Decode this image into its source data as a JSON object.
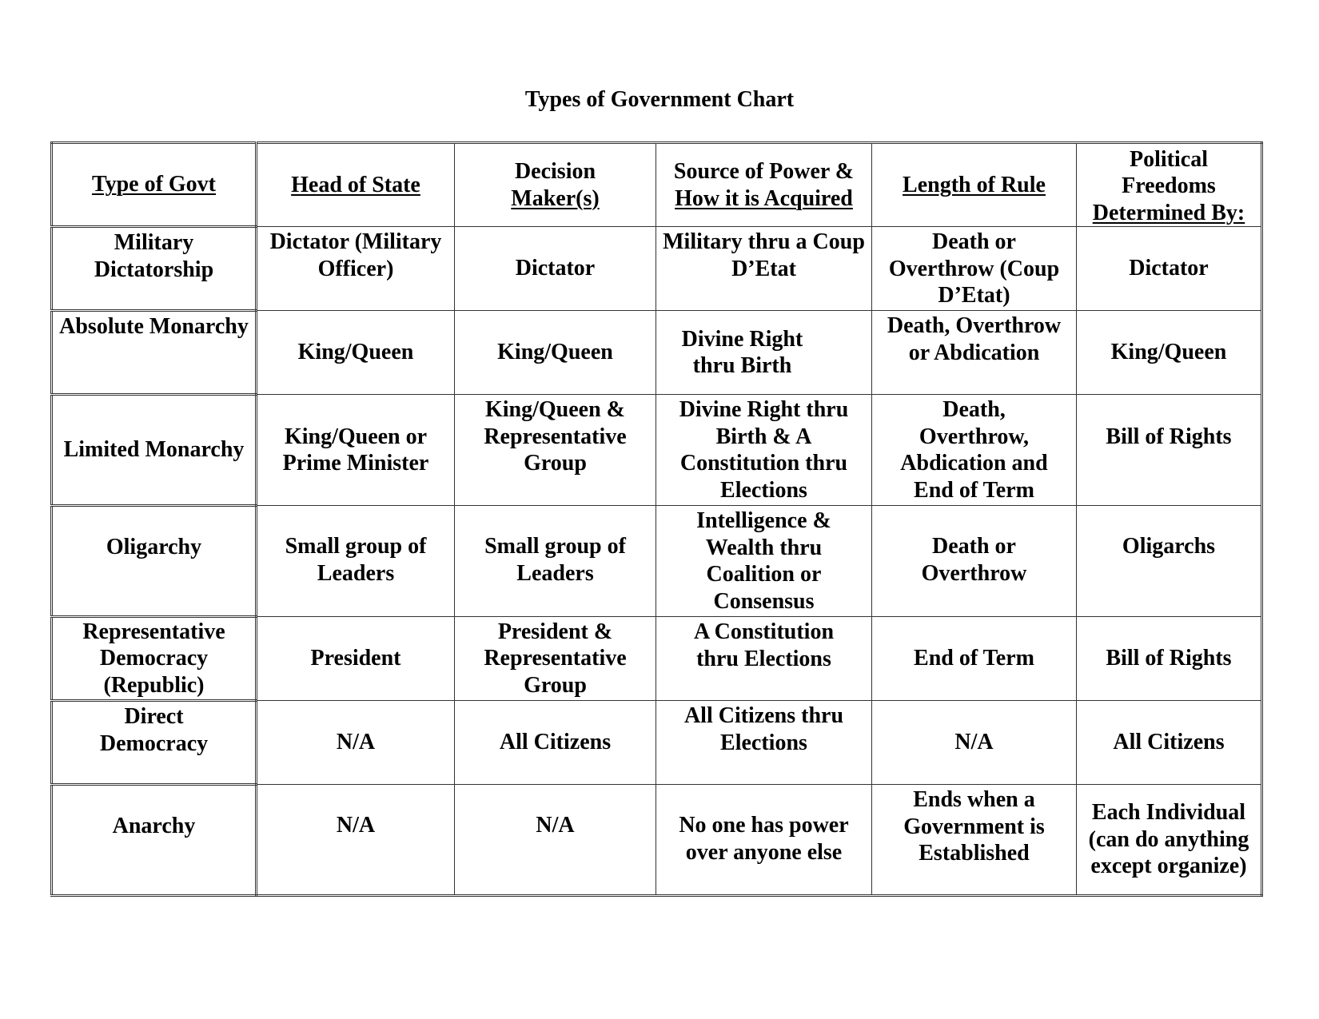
{
  "document": {
    "title": "Types of Government Chart"
  },
  "table": {
    "headers": [
      {
        "lines_plain": "",
        "lines_underlined": "Type of Govt"
      },
      {
        "lines_plain": "",
        "lines_underlined": "Head of State"
      },
      {
        "lines_plain": "Decision",
        "lines_underlined": "Maker(s)"
      },
      {
        "lines_plain": "Source of Power &",
        "lines_underlined": "How it is Acquired"
      },
      {
        "lines_plain": "",
        "lines_underlined": "Length of Rule"
      },
      {
        "lines_plain": "Political Freedoms",
        "lines_underlined": "Determined By:"
      }
    ],
    "rows": [
      {
        "type": "Military Dictatorship",
        "head_of_state": "Dictator (Military Officer)",
        "decision_makers": "Dictator",
        "source_of_power": "Military thru a Coup D’Etat",
        "length_of_rule": "Death or Overthrow (Coup D’Etat)",
        "political_freedoms": "Dictator"
      },
      {
        "type": "Absolute Monarchy",
        "head_of_state": "King/Queen",
        "decision_makers": "King/Queen",
        "source_of_power": "Divine Right thru Birth",
        "length_of_rule": "Death, Overthrow or Abdication",
        "political_freedoms": "King/Queen"
      },
      {
        "type": "Limited Monarchy",
        "head_of_state": "King/Queen or Prime Minister",
        "decision_makers": "King/Queen & Representative Group",
        "source_of_power": "Divine Right thru Birth & A Constitution thru Elections",
        "length_of_rule": "Death, Overthrow, Abdication and End of Term",
        "political_freedoms": "Bill of Rights"
      },
      {
        "type": "Oligarchy",
        "head_of_state": "Small group of Leaders",
        "decision_makers": "Small group of Leaders",
        "source_of_power": "Intelligence & Wealth thru Coalition or Consensus",
        "length_of_rule": "Death or Overthrow",
        "political_freedoms": "Oligarchs"
      },
      {
        "type": "Representative Democracy (Republic)",
        "head_of_state": "President",
        "decision_makers": "President & Representative Group",
        "source_of_power": "A Constitution thru Elections",
        "length_of_rule": "End of Term",
        "political_freedoms": "Bill of Rights"
      },
      {
        "type": "Direct Democracy",
        "head_of_state": "N/A",
        "decision_makers": "All Citizens",
        "source_of_power": "All Citizens thru Elections",
        "length_of_rule": "N/A",
        "political_freedoms": "All Citizens"
      },
      {
        "type": "Anarchy",
        "head_of_state": "N/A",
        "decision_makers": "N/A",
        "source_of_power": "No one has power over anyone else",
        "length_of_rule": "Ends when a Government is Established",
        "political_freedoms": "Each Individual (can do anything except organize)"
      }
    ]
  }
}
